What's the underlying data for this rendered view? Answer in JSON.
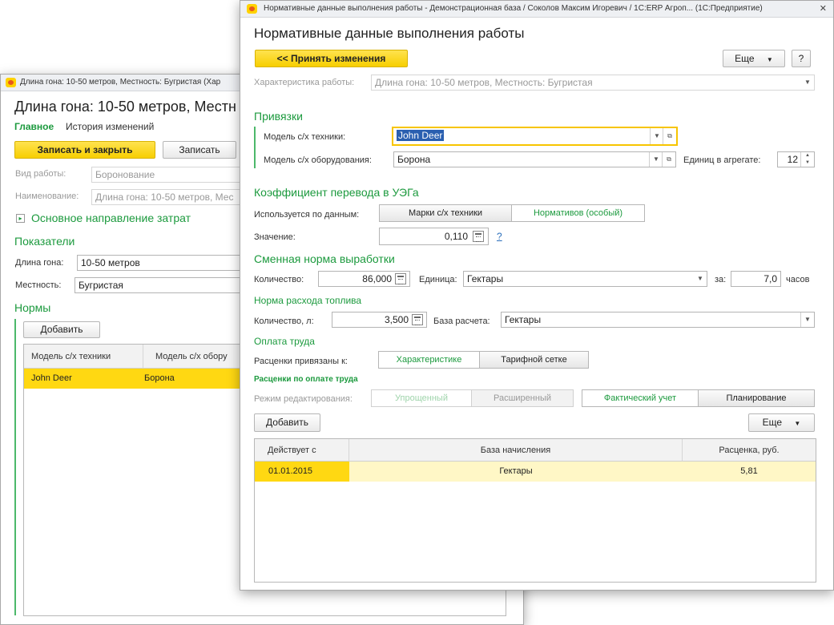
{
  "back_window": {
    "title": "Длина гона: 10-50 метров, Местность: Бугристая (Хар",
    "heading": "Длина гона: 10-50 метров, Местн",
    "tabs": {
      "main": "Главное",
      "history": "История изменений"
    },
    "buttons": {
      "save_close": "Записать и закрыть",
      "save": "Записать",
      "add": "Добавить"
    },
    "fields": {
      "work_type_label": "Вид работы:",
      "work_type_value": "Боронование",
      "name_label": "Наименование:",
      "name_value": "Длина гона: 10-50 метров, Мес",
      "length_label": "Длина гона:",
      "length_value": "10-50 метров",
      "terrain_label": "Местность:",
      "terrain_value": "Бугристая"
    },
    "cost_direction": "Основное направление затрат",
    "indicators_title": "Показатели",
    "norms_title": "Нормы",
    "table": {
      "columns": [
        "Модель с/х техники",
        "Модель с/х обору"
      ],
      "rows": [
        [
          "John Deer",
          "Борона"
        ]
      ]
    }
  },
  "front_window": {
    "title": "Нормативные данные выполнения работы - Демонстрационная база / Соколов Максим Игоревич / 1С:ERP Агроп...  (1С:Предприятие)",
    "close_glyph": "✕",
    "heading": "Нормативные данные выполнения работы",
    "accept_button": "<< Принять изменения",
    "more_label": "Еще",
    "help_label": "?",
    "characteristic_label": "Характеристика работы:",
    "characteristic_value": "Длина гона: 10-50 метров, Местность: Бугристая",
    "bindings_title": "Привязки",
    "machine_label": "Модель с/х техники:",
    "machine_value": "John Deer",
    "equipment_label": "Модель с/х оборудования:",
    "equipment_value": "Борона",
    "units_label": "Единиц в агрегате:",
    "units_value": "12",
    "coef_title": "Коэффициент перевода в УЭГа",
    "used_by_label": "Используется по данным:",
    "used_by_options": [
      "Марки с/х техники",
      "Нормативов (особый)"
    ],
    "value_label": "Значение:",
    "value_value": "0,110",
    "help_link": "?",
    "shift_title": "Сменная норма выработки",
    "qty_label": "Количество:",
    "qty_value": "86,000",
    "unit_label": "Единица:",
    "unit_value": "Гектары",
    "per_label": "за:",
    "per_value": "7,0",
    "hours_label": "часов",
    "fuel_title": "Норма расхода топлива",
    "fuel_qty_label": "Количество, л:",
    "fuel_qty_value": "3,500",
    "base_label": "База расчета:",
    "base_value": "Гектары",
    "labor_title": "Оплата труда",
    "rates_linked_label": "Расценки привязаны к:",
    "rates_linked_options": [
      "Характеристике",
      "Тарифной сетке"
    ],
    "rates_title": "Расценки по оплате труда",
    "edit_mode_label": "Режим редактирования:",
    "edit_mode_options": [
      "Упрощенный",
      "Расширенный"
    ],
    "plan_options": [
      "Фактический учет",
      "Планирование"
    ],
    "add_button": "Добавить",
    "table": {
      "columns": [
        "Действует с",
        "База начисления",
        "Расценка, руб."
      ],
      "rows": [
        [
          "01.01.2015",
          "Гектары",
          "5,81"
        ]
      ]
    }
  },
  "colors": {
    "accent": "#1c9a3e",
    "button_yellow": "#f7cf00",
    "row_highlight": "#fff7c6",
    "selected_row": "#ffd812"
  },
  "icons": [
    "logo-icon",
    "dropdown-arrow-icon",
    "open-form-icon",
    "calculator-icon",
    "expand-icon",
    "spinner-icon"
  ]
}
